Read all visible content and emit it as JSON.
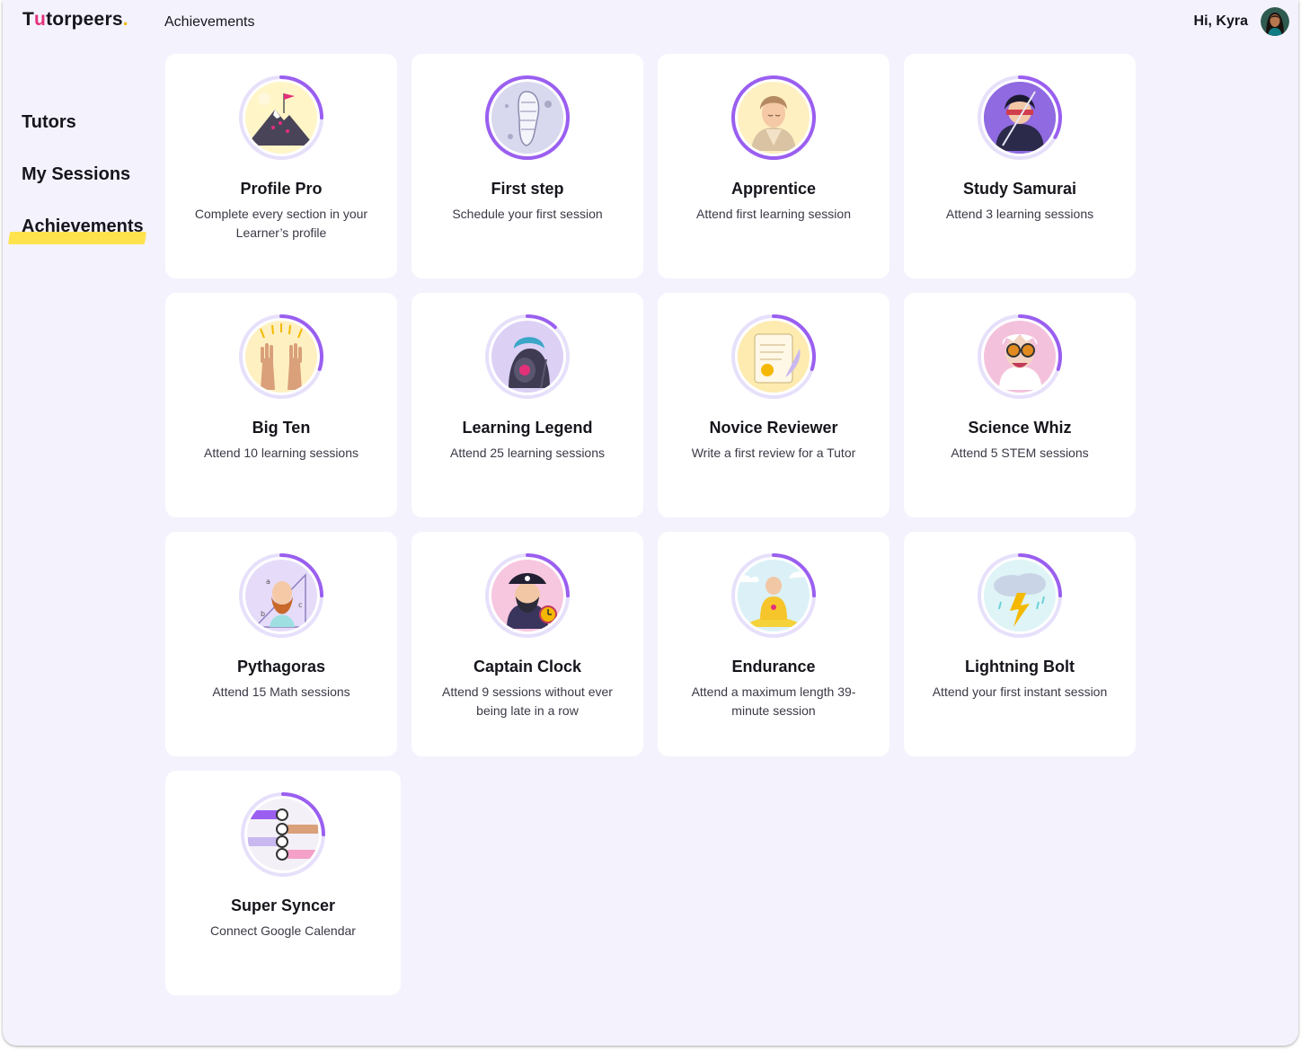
{
  "header": {
    "logo": {
      "brand_start": "T",
      "brand_u": "u",
      "brand_rest": "torpeers",
      "brand_dot": "."
    },
    "page_title": "Achievements",
    "greeting": "Hi, Kyra",
    "avatar_icon": "user-avatar"
  },
  "sidebar": {
    "items": [
      {
        "label": "Tutors",
        "active": false
      },
      {
        "label": "My Sessions",
        "active": false
      },
      {
        "label": "Achievements",
        "active": true
      }
    ]
  },
  "colors": {
    "accent": "#9a5ff0",
    "ring_track": "#e7e0fb",
    "highlight": "#ffe34d",
    "background": "#f4f2fd"
  },
  "achievements": [
    {
      "title": "Profile Pro",
      "description": "Complete every section in your Learner’s profile",
      "icon": "mountain-flag-icon",
      "progress": 0.25,
      "bg": "#fff5c7"
    },
    {
      "title": "First step",
      "description": "Schedule your first session",
      "icon": "footprint-moon-icon",
      "progress": 1.0,
      "bg": "#d8d8ee"
    },
    {
      "title": "Apprentice",
      "description": "Attend first learning session",
      "icon": "apprentice-icon",
      "progress": 1.0,
      "bg": "#fff0c2"
    },
    {
      "title": "Study Samurai",
      "description": "Attend 3 learning sessions",
      "icon": "samurai-icon",
      "progress": 0.33,
      "bg": "#b69be8"
    },
    {
      "title": "Big Ten",
      "description": "Attend 10 learning sessions",
      "icon": "raised-hands-icon",
      "progress": 0.3,
      "bg": "#fff0c2"
    },
    {
      "title": "Learning Legend",
      "description": "Attend 25 learning sessions",
      "icon": "spartan-helmet-icon",
      "progress": 0.12,
      "bg": "#dcd0f5"
    },
    {
      "title": "Novice Reviewer",
      "description": "Write a first review for a Tutor",
      "icon": "scroll-quill-icon",
      "progress": 0.3,
      "bg": "#fdebb0"
    },
    {
      "title": "Science Whiz",
      "description": "Attend 5 STEM sessions",
      "icon": "scientist-goggles-icon",
      "progress": 0.3,
      "bg": "#f4c1dc"
    },
    {
      "title": "Pythagoras",
      "description": "Attend 15 Math sessions",
      "icon": "pythagoras-icon",
      "progress": 0.25,
      "bg": "#e6dcfa"
    },
    {
      "title": "Captain Clock",
      "description": "Attend 9 sessions without ever being late in a row",
      "icon": "pirate-clock-icon",
      "progress": 0.25,
      "bg": "#f7c6df"
    },
    {
      "title": "Endurance",
      "description": "Attend a maximum length 39-minute session",
      "icon": "meditating-monk-icon",
      "progress": 0.25,
      "bg": "#dbf1f7"
    },
    {
      "title": "Lightning Bolt",
      "description": "Attend your first instant session",
      "icon": "lightning-cloud-icon",
      "progress": 0.25,
      "bg": "#dff4f6"
    },
    {
      "title": "Super Syncer",
      "description": "Connect Google Calendar",
      "icon": "synced-watches-icon",
      "progress": 0.25,
      "bg": "#f3f0f8"
    }
  ]
}
